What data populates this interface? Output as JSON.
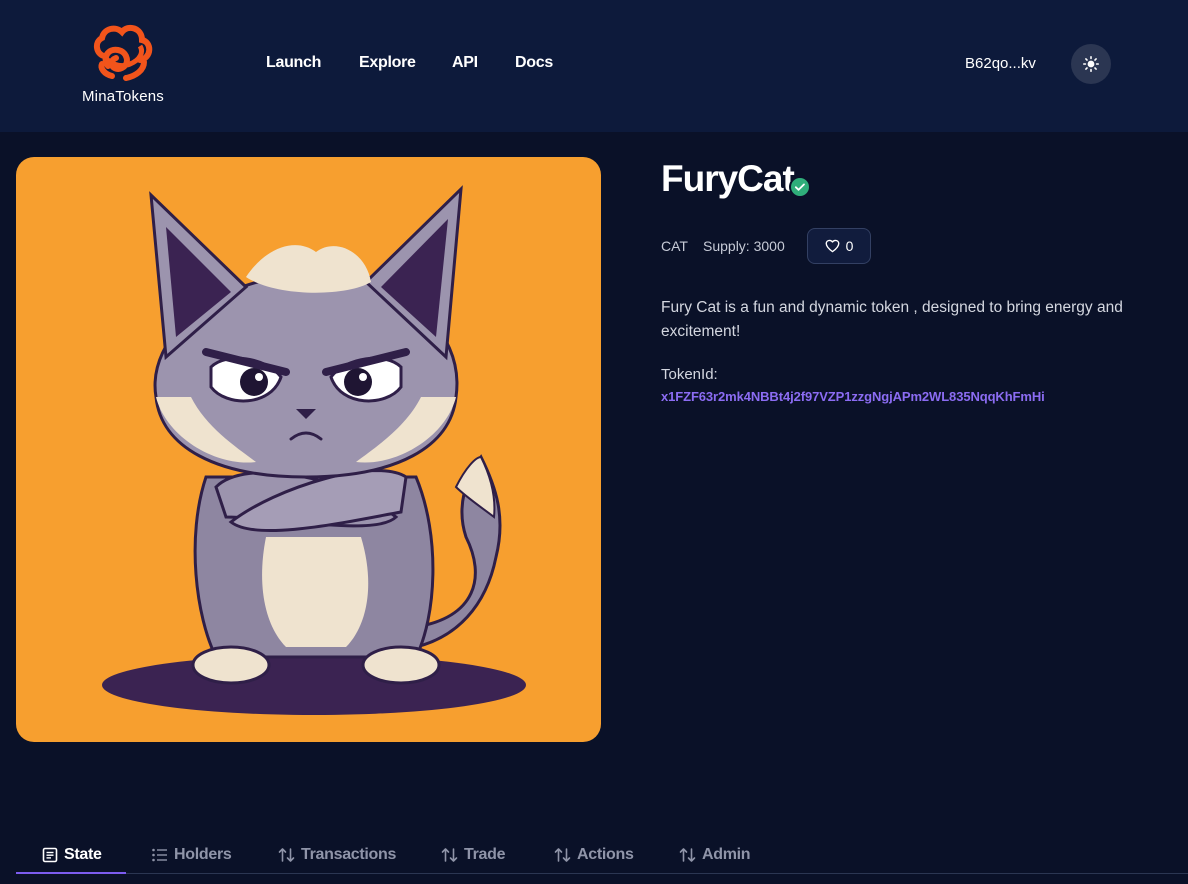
{
  "header": {
    "logo_text": "MinaTokens",
    "nav": [
      "Launch",
      "Explore",
      "API",
      "Docs"
    ],
    "wallet_address": "B62qo...kv",
    "theme_icon": "sun-icon",
    "logo_color": "#f2541b"
  },
  "token": {
    "name": "FuryCat",
    "verified_icon": "check-badge-icon",
    "symbol": "CAT",
    "supply": "Supply: 3000",
    "likes": "0",
    "description": "Fury Cat is a fun and dynamic token , designed to bring energy and excitement!",
    "token_id_label": "TokenId:",
    "token_id": "x1FZF63r2mk4NBBt4j2f97VZP1zzgNgjAPm2WL835NqqKhFmHi",
    "image_background": "#f79f2f"
  },
  "tabs": [
    {
      "label": "State",
      "icon": "document-icon",
      "active": true
    },
    {
      "label": "Holders",
      "icon": "list-icon",
      "active": false
    },
    {
      "label": "Transactions",
      "icon": "arrows-up-down-icon",
      "active": false
    },
    {
      "label": "Trade",
      "icon": "arrows-up-down-icon",
      "active": false
    },
    {
      "label": "Actions",
      "icon": "arrows-up-down-icon",
      "active": false
    },
    {
      "label": "Admin",
      "icon": "arrows-up-down-icon",
      "active": false
    }
  ],
  "colors": {
    "background": "#0a1128",
    "header": "#0d1a3b",
    "accent": "#8b6cf2",
    "verified": "#2fae7a"
  }
}
